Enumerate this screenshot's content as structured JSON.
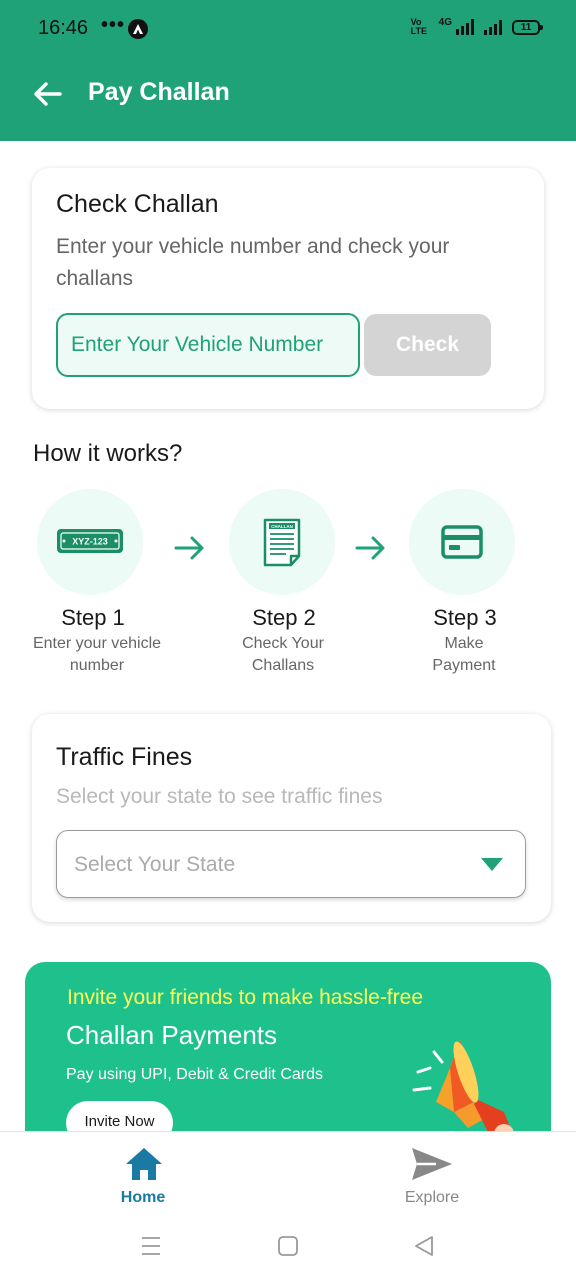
{
  "status_bar": {
    "time": "16:46",
    "dots": "•••",
    "volte_label": "Vo LTE",
    "network_label": "4G",
    "battery_level": "11"
  },
  "header": {
    "title": "Pay Challan",
    "background_color": "#1fa277"
  },
  "check_challan": {
    "title": "Check Challan",
    "description": "Enter your vehicle number and check your challans",
    "input_placeholder": "Enter Your Vehicle Number",
    "input_value": "",
    "check_button_label": "Check"
  },
  "how_it_works": {
    "title": "How it works?",
    "steps": [
      {
        "title": "Step 1",
        "description": "Enter your vehicle number",
        "icon": "number-plate-icon",
        "plate_text": "XYZ-123"
      },
      {
        "title": "Step 2",
        "description": "Check Your Challans",
        "icon": "challan-document-icon",
        "doc_text": "CHALLAN"
      },
      {
        "title": "Step 3",
        "description": "Make Payment",
        "icon": "card-payment-icon"
      }
    ]
  },
  "traffic_fines": {
    "title": "Traffic Fines",
    "description": "Select your state to see traffic fines",
    "select_placeholder": "Select Your State"
  },
  "invite_banner": {
    "line1": "Invite your friends to make hassle-free",
    "line2": "Challan Payments",
    "line3": "Pay using UPI, Debit & Credit Cards",
    "button_label": "Invite Now",
    "accent_color": "#1ec18c",
    "icon": "megaphone-icon"
  },
  "bottom_nav": {
    "items": [
      {
        "label": "Home",
        "icon": "home-icon",
        "active": true,
        "color": "#1a7aa3"
      },
      {
        "label": "Explore",
        "icon": "send-icon",
        "active": false,
        "color": "#888888"
      }
    ]
  },
  "system_nav": {
    "icons": [
      "menu-icon",
      "home-square-icon",
      "back-triangle-icon"
    ]
  }
}
